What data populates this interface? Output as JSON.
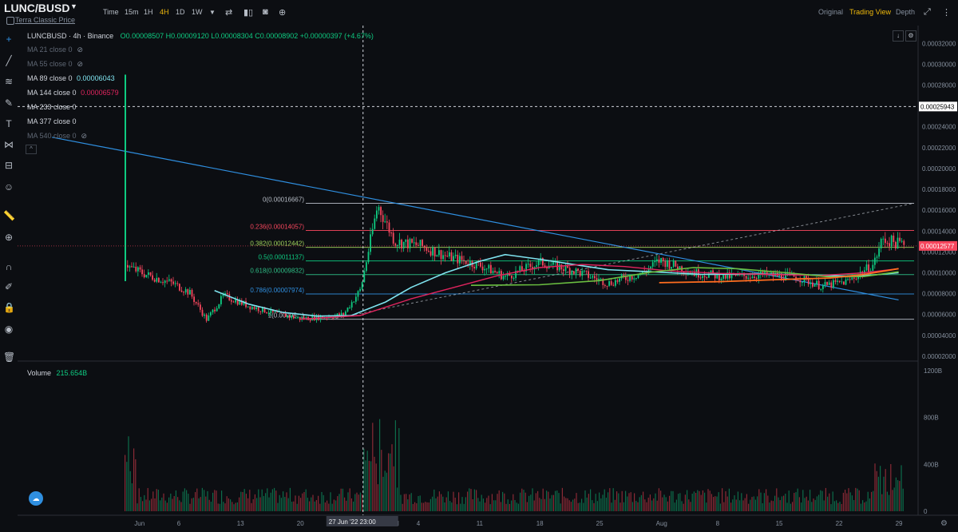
{
  "header": {
    "pair": "LUNC/BUSD",
    "subtitle": "Terra Classic Price",
    "intervals": [
      "Time",
      "15m",
      "1H",
      "4H",
      "1D",
      "1W"
    ],
    "active_interval": "4H",
    "views": [
      "Original",
      "Trading View",
      "Depth"
    ],
    "active_view": "Trading View"
  },
  "legend": {
    "symbol": "LUNCBUSD",
    "interval": "4h",
    "exchange": "Binance",
    "ohlc": "O0.00008507 H0.00009120 L0.00008304 C0.00008902 +0.00000397 (+4.67%)",
    "ma": [
      {
        "label": "MA 21 close 0",
        "value": "",
        "visible": false
      },
      {
        "label": "MA 55 close 0",
        "value": "",
        "visible": false
      },
      {
        "label": "MA 89 close 0",
        "value": "0.00006043",
        "color": "#7fe3ef",
        "visible": true
      },
      {
        "label": "MA 144 close 0",
        "value": "0.00006579",
        "color": "#e0245e",
        "visible": true
      },
      {
        "label": "MA 233 close 0",
        "value": "",
        "visible": true
      },
      {
        "label": "MA 377 close 0",
        "value": "",
        "visible": true
      },
      {
        "label": "MA 540 close 0",
        "value": "",
        "visible": false
      }
    ]
  },
  "volume": {
    "label": "Volume",
    "value": "215.654B"
  },
  "colors": {
    "up": "#0ecb81",
    "down": "#f6465d",
    "accent": "#f0b90b",
    "fib": "#b7bdc6"
  },
  "fib_levels": [
    {
      "ratio": "0",
      "label": "0(0.00016667)",
      "price": 0.00016667,
      "color": "#b7bdc6"
    },
    {
      "ratio": "0.236",
      "label": "0.236(0.00014057)",
      "price": 0.00014057,
      "color": "#f6465d"
    },
    {
      "ratio": "0.382",
      "label": "0.382(0.00012442)",
      "price": 0.00012442,
      "color": "#9ed15b"
    },
    {
      "ratio": "0.5",
      "label": "0.5(0.00011137)",
      "price": 0.00011137,
      "color": "#0ecb81"
    },
    {
      "ratio": "0.618",
      "label": "0.618(0.00009832)",
      "price": 9.832e-05,
      "color": "#2ebd85"
    },
    {
      "ratio": "0.786",
      "label": "0.786(0.00007974)",
      "price": 7.974e-05,
      "color": "#2f8fe0"
    },
    {
      "ratio": "1",
      "label": "1(0.00005...)",
      "price": 5.55e-05,
      "color": "#b7bdc6"
    }
  ],
  "chart_data": {
    "type": "candlestick",
    "price_axis_ticks": [
      "0.00032000",
      "0.00030000",
      "0.00028000",
      "0.00026000",
      "0.00024000",
      "0.00022000",
      "0.00020000",
      "0.00018000",
      "0.00016000",
      "0.00014000",
      "0.00012000",
      "0.00010000",
      "0.00008000",
      "0.00006000",
      "0.00004000",
      "0.00002000"
    ],
    "price_axis_range": [
      1e-05,
      0.000334
    ],
    "volume_axis_ticks": [
      "1200B",
      "800B",
      "400B",
      "0"
    ],
    "volume_axis_range": [
      0,
      1200
    ],
    "time_ticks": [
      "Jun",
      "6",
      "13",
      "20",
      "27 Jun '22",
      "23:00",
      "Jul",
      "4",
      "11",
      "18",
      "25",
      "Aug",
      "8",
      "15",
      "22",
      "29"
    ],
    "date_range": [
      "2022-05-30",
      "2022-08-29"
    ],
    "last_price": "0.00012577",
    "hline_price": "0.00025943",
    "crosshair_time_label": "27 Jun '22   23:00",
    "trendline": {
      "from": [
        "2022-05-22",
        0.00023
      ],
      "to": [
        "2022-08-29",
        7.4e-05
      ]
    },
    "close_path": [
      [
        "2022-05-28",
        0.00026
      ],
      [
        "2022-05-29",
        0.000125
      ],
      [
        "2022-05-31",
        0.000105
      ],
      [
        "2022-06-02",
        9.8e-05
      ],
      [
        "2022-06-05",
        9e-05
      ],
      [
        "2022-06-07",
        8.1e-05
      ],
      [
        "2022-06-09",
        5.5e-05
      ],
      [
        "2022-06-11",
        7.8e-05
      ],
      [
        "2022-06-14",
        6.8e-05
      ],
      [
        "2022-06-17",
        6.1e-05
      ],
      [
        "2022-06-20",
        5.6e-05
      ],
      [
        "2022-06-23",
        5.8e-05
      ],
      [
        "2022-06-25",
        6e-05
      ],
      [
        "2022-06-27",
        8.4e-05
      ],
      [
        "2022-06-29",
        0.000165
      ],
      [
        "2022-07-01",
        0.00013
      ],
      [
        "2022-07-04",
        0.000126
      ],
      [
        "2022-07-07",
        0.000116
      ],
      [
        "2022-07-11",
        0.000107
      ],
      [
        "2022-07-14",
        9.6e-05
      ],
      [
        "2022-07-18",
        0.00011
      ],
      [
        "2022-07-22",
        0.000102
      ],
      [
        "2022-07-26",
        9e-05
      ],
      [
        "2022-07-30",
        0.0001
      ],
      [
        "2022-08-01",
        0.000112
      ],
      [
        "2022-08-05",
        0.0001
      ],
      [
        "2022-08-09",
        9.6e-05
      ],
      [
        "2022-08-13",
        9.8e-05
      ],
      [
        "2022-08-17",
        9.6e-05
      ],
      [
        "2022-08-20",
        8.7e-05
      ],
      [
        "2022-08-23",
        9.2e-05
      ],
      [
        "2022-08-26",
        0.000108
      ],
      [
        "2022-08-27",
        0.000132
      ],
      [
        "2022-08-29",
        0.000128
      ]
    ]
  }
}
